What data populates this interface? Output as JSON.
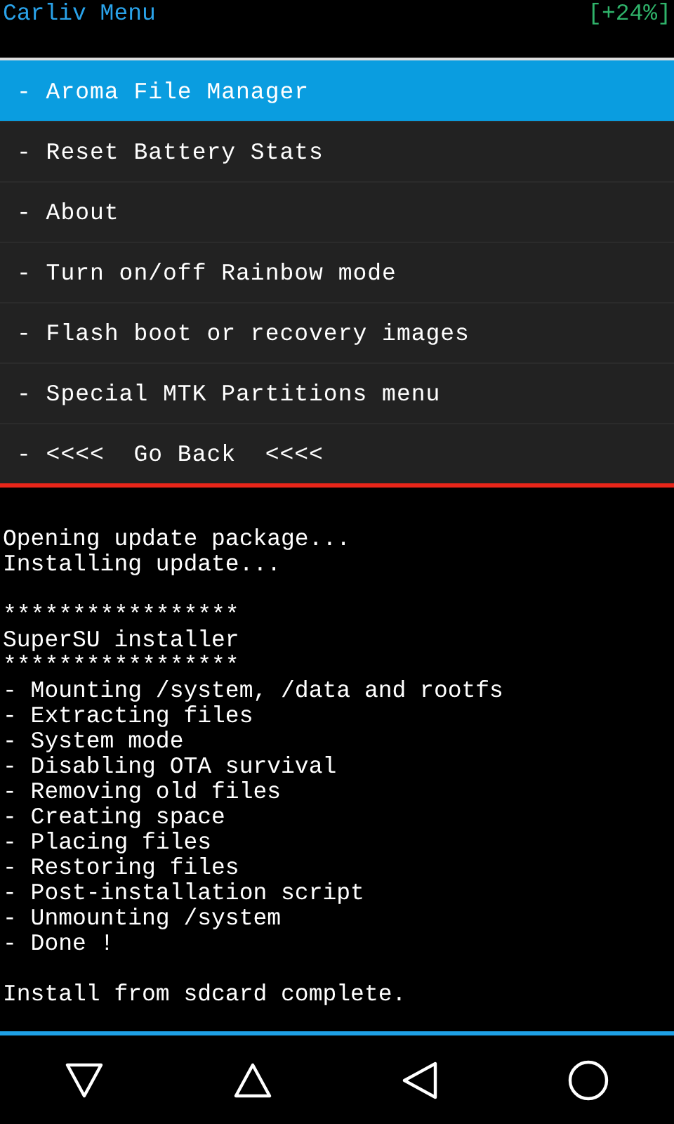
{
  "header": {
    "title": "Carliv Menu",
    "battery": "[+24%]"
  },
  "menu": [
    {
      "label": "- Aroma File Manager",
      "selected": true
    },
    {
      "label": "- Reset Battery Stats",
      "selected": false
    },
    {
      "label": "- About",
      "selected": false
    },
    {
      "label": "- Turn on/off Rainbow mode",
      "selected": false
    },
    {
      "label": "- Flash boot or recovery images",
      "selected": false
    },
    {
      "label": "- Special MTK Partitions menu",
      "selected": false
    },
    {
      "label": "- <<<<  Go Back  <<<<",
      "selected": false
    }
  ],
  "log": [
    [
      "Opening update package...",
      "Installing update..."
    ],
    [
      "*****************",
      "SuperSU installer",
      "*****************",
      "- Mounting /system, /data and rootfs",
      "- Extracting files",
      "- System mode",
      "- Disabling OTA survival",
      "- Removing old files",
      "- Creating space",
      "- Placing files",
      "- Restoring files",
      "- Post-installation script",
      "- Unmounting /system",
      "- Done !"
    ],
    [
      "Install from sdcard complete."
    ]
  ]
}
